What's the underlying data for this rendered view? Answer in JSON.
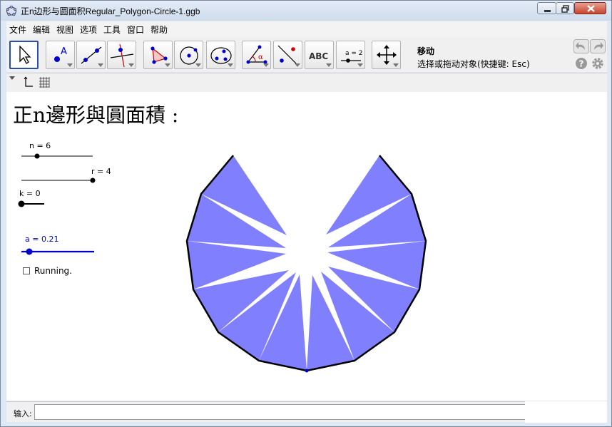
{
  "window": {
    "title": "正n边形与圆面积Regular_Polygon-Circle-1.ggb",
    "icon": "geogebra-icon"
  },
  "menu": {
    "items": [
      "文件",
      "编辑",
      "视图",
      "选项",
      "工具",
      "窗口",
      "帮助"
    ]
  },
  "toolbar": {
    "tools": [
      {
        "name": "move",
        "icon": "arrow-cursor-icon",
        "active": true
      },
      {
        "name": "point",
        "icon": "point-icon"
      },
      {
        "name": "line",
        "icon": "line-through-two-points-icon"
      },
      {
        "name": "perpendicular",
        "icon": "perpendicular-line-icon"
      },
      {
        "name": "polygon",
        "icon": "polygon-icon"
      },
      {
        "name": "circle",
        "icon": "circle-center-point-icon"
      },
      {
        "name": "conic",
        "icon": "conic-five-points-icon"
      },
      {
        "name": "angle",
        "icon": "angle-icon"
      },
      {
        "name": "reflect",
        "icon": "reflect-about-line-icon"
      },
      {
        "name": "text",
        "icon": "text-abc-icon",
        "label": "ABC"
      },
      {
        "name": "slider",
        "icon": "slider-icon",
        "label": "a = 2"
      },
      {
        "name": "move-graphics",
        "icon": "move-graphics-view-icon"
      }
    ],
    "current_tool_name": "移动",
    "current_tool_help": "选择或拖动对象(快捷键: Esc)"
  },
  "graphics": {
    "heading": "正n邊形與圓面積 :",
    "sliders": {
      "n": {
        "label": "n = 6",
        "value": 6
      },
      "r": {
        "label": "r = 4",
        "value": 4
      },
      "k": {
        "label": "k = 0",
        "value": 0
      },
      "a": {
        "label": "a = 0.21",
        "value": 0.21
      }
    },
    "checkbox": {
      "label": "Running.",
      "checked": false
    },
    "colors": {
      "fill": "#8080ff",
      "outline": "#000000",
      "accent": "#0000cc"
    }
  },
  "input_bar": {
    "label": "输入:",
    "value": ""
  }
}
